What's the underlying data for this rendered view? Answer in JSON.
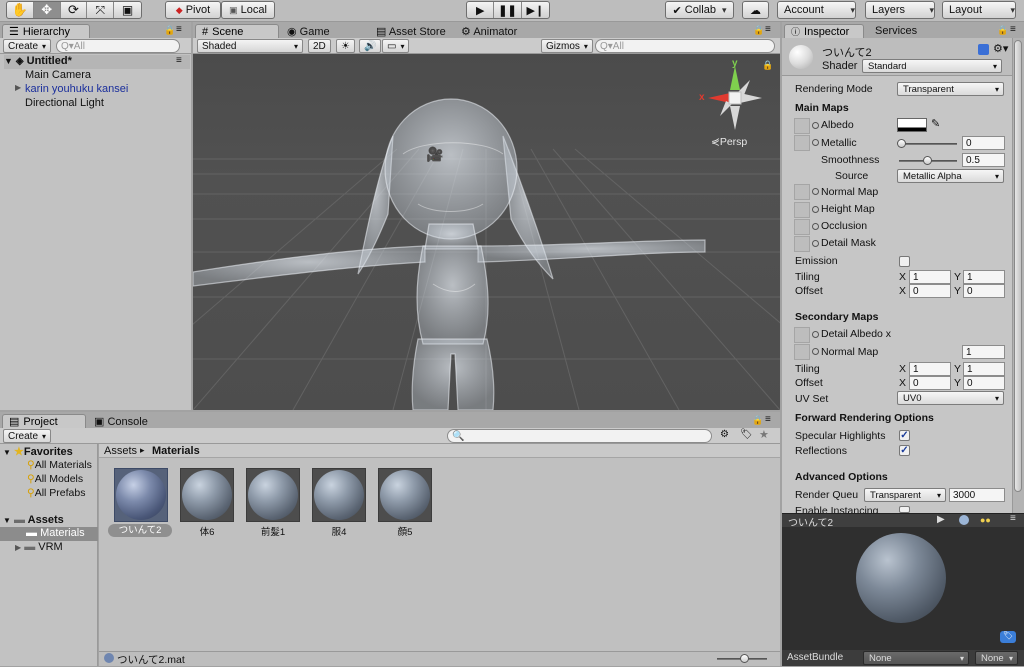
{
  "toolbar": {
    "tools": [
      "hand-tool-icon",
      "move-tool-icon",
      "rotate-tool-icon",
      "scale-tool-icon",
      "rect-tool-icon"
    ],
    "pivot": "Pivot",
    "local": "Local",
    "collab": "Collab",
    "account": "Account",
    "layers": "Layers",
    "layout": "Layout"
  },
  "hierarchy": {
    "tab": "Hierarchy",
    "create": "Create",
    "search_placeholder": "Q▾All",
    "scene": "Untitled*",
    "items": [
      "Main Camera",
      "karin youhuku kansei",
      "Directional Light"
    ]
  },
  "scene_view": {
    "tabs": [
      "Scene",
      "Game",
      "Asset Store",
      "Animator"
    ],
    "shading": "Shaded",
    "mode_2d": "2D",
    "gizmos": "Gizmos",
    "search_placeholder": "Q▾All",
    "persp": "Persp",
    "axis_y": "y",
    "axis_x": "x"
  },
  "inspector": {
    "tabs": [
      "Inspector",
      "Services"
    ],
    "material_name": "ついんて2",
    "shader_label": "Shader",
    "shader_value": "Standard",
    "rendering_mode_label": "Rendering Mode",
    "rendering_mode_value": "Transparent",
    "main_maps": "Main Maps",
    "albedo": "Albedo",
    "metallic": "Metallic",
    "metallic_value": "0",
    "smoothness": "Smoothness",
    "smoothness_value": "0.5",
    "source": "Source",
    "source_value": "Metallic Alpha",
    "normal_map": "Normal Map",
    "height_map": "Height Map",
    "occlusion": "Occlusion",
    "detail_mask": "Detail Mask",
    "emission": "Emission",
    "tiling": "Tiling",
    "offset": "Offset",
    "x": "X",
    "y": "Y",
    "tiling_x": "1",
    "tiling_y": "1",
    "offset_x": "0",
    "offset_y": "0",
    "secondary_maps": "Secondary Maps",
    "detail_albedo": "Detail Albedo x",
    "normal_map2": "Normal Map",
    "normal_map2_value": "1",
    "tiling2_x": "1",
    "tiling2_y": "1",
    "offset2_x": "0",
    "offset2_y": "0",
    "uv_set": "UV Set",
    "uv_set_value": "UV0",
    "forward_options": "Forward Rendering Options",
    "specular_highlights": "Specular Highlights",
    "reflections": "Reflections",
    "advanced_options": "Advanced Options",
    "render_queue": "Render Queu",
    "render_queue_mode": "Transparent",
    "render_queue_value": "3000",
    "enable_instancing": "Enable Instancing",
    "preview_name": "ついんて2",
    "asset_bundle": "AssetBundle",
    "asset_bundle_value": "None",
    "asset_variant_value": "None"
  },
  "project": {
    "tabs": [
      "Project",
      "Console"
    ],
    "create": "Create",
    "favorites": "Favorites",
    "favorite_items": [
      "All Materials",
      "All Models",
      "All Prefabs"
    ],
    "assets": "Assets",
    "asset_folders": [
      "Materials",
      "VRM"
    ],
    "breadcrumb_root": "Assets",
    "breadcrumb_current": "Materials",
    "materials": [
      "ついんて2",
      "体6",
      "前髪1",
      "服4",
      "顔5"
    ],
    "selected_file": "ついんて2.mat"
  }
}
